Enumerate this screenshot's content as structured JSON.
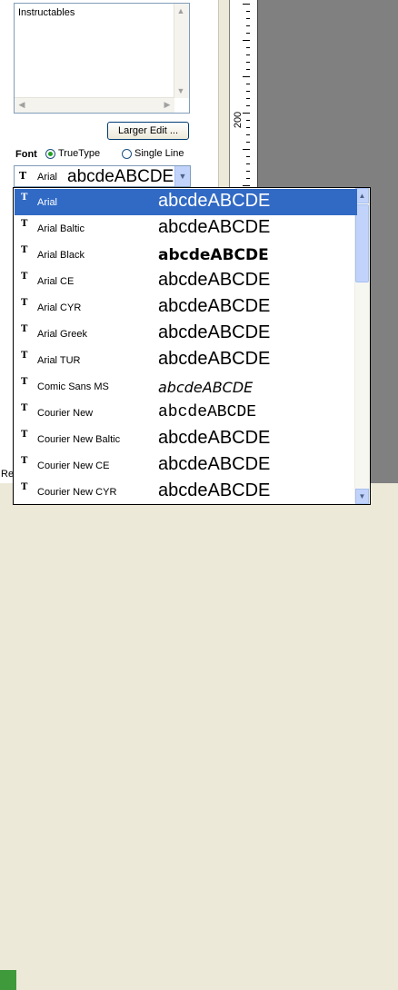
{
  "text_panel": {
    "content": "Instructables"
  },
  "larger_edit_label": "Larger Edit ...",
  "font_section": {
    "label": "Font",
    "option_truetype": "TrueType",
    "option_singleline": "Single Line",
    "selected_option": "TrueType"
  },
  "combo": {
    "type_glyph": "T̂",
    "current_font": "Arial",
    "sample": "abcdeABCDE"
  },
  "ruler": {
    "label": "200"
  },
  "status": {
    "text": "Re"
  },
  "font_list": {
    "selected": "Arial",
    "items": [
      {
        "name": "Arial",
        "sample": "abcdeABCDE"
      },
      {
        "name": "Arial Baltic",
        "sample": "abcdeABCDE"
      },
      {
        "name": "Arial Black",
        "sample": "abcdeABCDE"
      },
      {
        "name": "Arial CE",
        "sample": "abcdeABCDE"
      },
      {
        "name": "Arial CYR",
        "sample": "abcdeABCDE"
      },
      {
        "name": "Arial Greek",
        "sample": "abcdeABCDE"
      },
      {
        "name": "Arial TUR",
        "sample": "abcdeABCDE"
      },
      {
        "name": "Comic Sans MS",
        "sample": "abcdeABCDE"
      },
      {
        "name": "Courier New",
        "sample": "abcdeABCDE"
      },
      {
        "name": "Courier New Baltic",
        "sample": "abcdeABCDE"
      },
      {
        "name": "Courier New CE",
        "sample": "abcdeABCDE"
      },
      {
        "name": "Courier New CYR",
        "sample": "abcdeABCDE"
      }
    ]
  },
  "colors": {
    "selection": "#316ac5",
    "scroll_button": "#c1d3fb"
  }
}
